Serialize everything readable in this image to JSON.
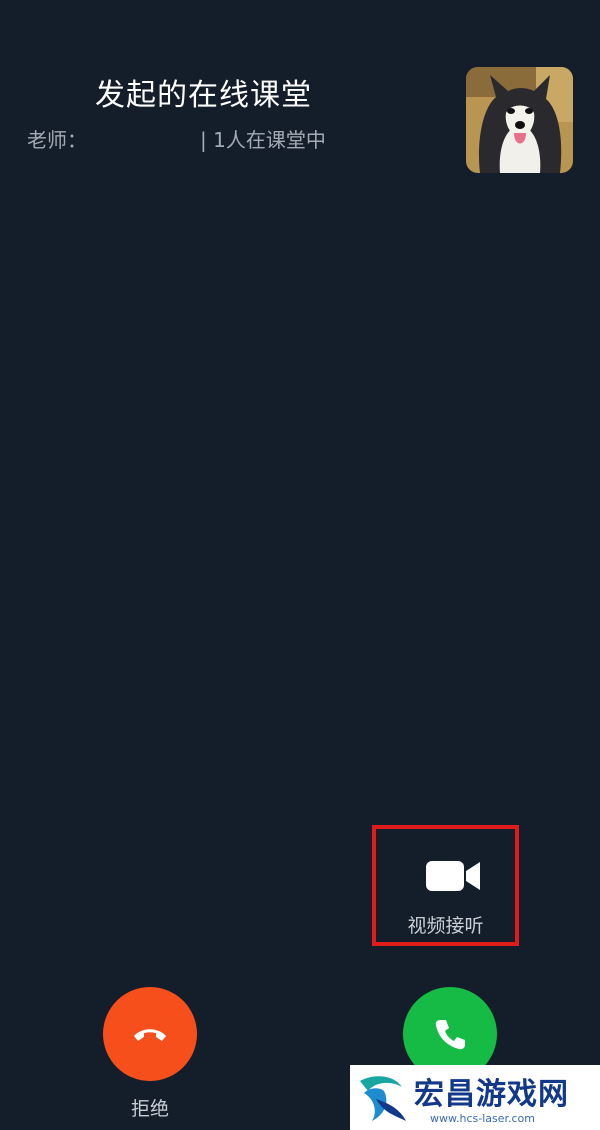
{
  "header": {
    "title": "发起的在线课堂",
    "teacher_label": "老师：",
    "participants": "| 1人在课堂中"
  },
  "avatar": {
    "icon": "dog-avatar"
  },
  "video_answer": {
    "label": "视频接听",
    "icon": "video-camera-icon",
    "highlight_color": "#e01b1b"
  },
  "decline": {
    "label": "拒绝",
    "icon": "hang-up-icon",
    "color": "#f64f1c"
  },
  "accept": {
    "icon": "phone-icon",
    "color": "#15bb44"
  },
  "watermark": {
    "title": "宏昌游戏网",
    "url": "www.hcs-laser.com"
  },
  "colors": {
    "background": "#141e2b"
  }
}
